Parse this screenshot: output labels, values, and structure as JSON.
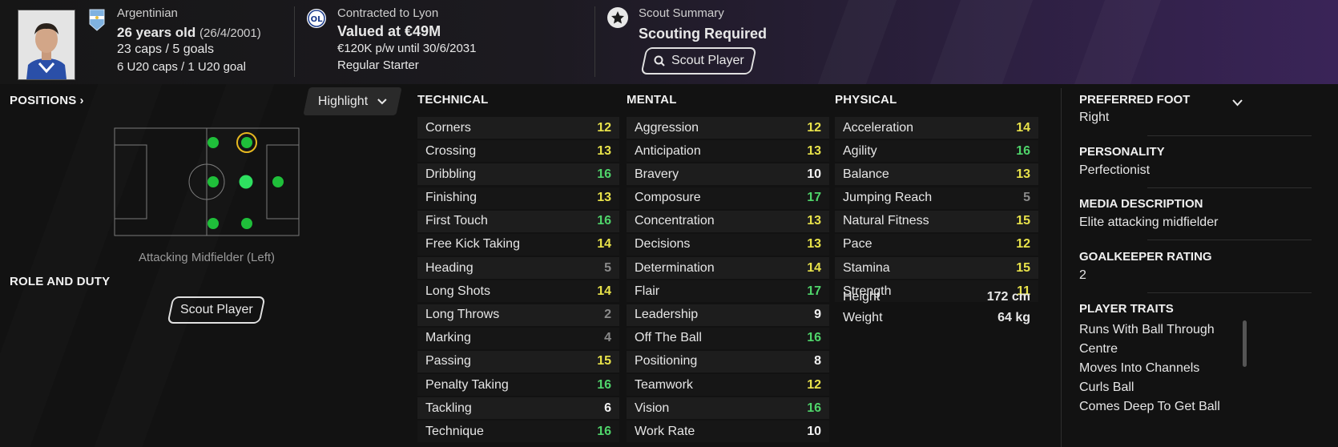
{
  "header": {
    "nationality": "Argentinian",
    "age": "26 years old",
    "dob": "(26/4/2001)",
    "caps": "23 caps / 5 goals",
    "u20": "6 U20 caps / 1 U20 goal",
    "contract_label": "Contracted to Lyon",
    "value": "Valued at €49M",
    "wage": "€120K p/w until 30/6/2031",
    "status": "Regular Starter",
    "scout_label": "Scout Summary",
    "scout_status": "Scouting Required",
    "scout_button": "Scout Player",
    "club_badge": "OL"
  },
  "positions": {
    "title": "POSITIONS",
    "highlight_label": "Highlight",
    "position_name": "Attacking Midfielder (Left)"
  },
  "role": {
    "title": "ROLE AND DUTY",
    "scout_button": "Scout Player"
  },
  "technical": {
    "title": "TECHNICAL",
    "rows": [
      {
        "label": "Corners",
        "value": "12",
        "tone": "yel"
      },
      {
        "label": "Crossing",
        "value": "13",
        "tone": "yel"
      },
      {
        "label": "Dribbling",
        "value": "16",
        "tone": "grn"
      },
      {
        "label": "Finishing",
        "value": "13",
        "tone": "yel"
      },
      {
        "label": "First Touch",
        "value": "16",
        "tone": "grn"
      },
      {
        "label": "Free Kick Taking",
        "value": "14",
        "tone": "yel"
      },
      {
        "label": "Heading",
        "value": "5",
        "tone": "gry"
      },
      {
        "label": "Long Shots",
        "value": "14",
        "tone": "yel"
      },
      {
        "label": "Long Throws",
        "value": "2",
        "tone": "gry"
      },
      {
        "label": "Marking",
        "value": "4",
        "tone": "gry"
      },
      {
        "label": "Passing",
        "value": "15",
        "tone": "yel"
      },
      {
        "label": "Penalty Taking",
        "value": "16",
        "tone": "grn"
      },
      {
        "label": "Tackling",
        "value": "6",
        "tone": "wht"
      },
      {
        "label": "Technique",
        "value": "16",
        "tone": "grn"
      }
    ]
  },
  "mental": {
    "title": "MENTAL",
    "rows": [
      {
        "label": "Aggression",
        "value": "12",
        "tone": "yel"
      },
      {
        "label": "Anticipation",
        "value": "13",
        "tone": "yel"
      },
      {
        "label": "Bravery",
        "value": "10",
        "tone": "wht"
      },
      {
        "label": "Composure",
        "value": "17",
        "tone": "grn"
      },
      {
        "label": "Concentration",
        "value": "13",
        "tone": "yel"
      },
      {
        "label": "Decisions",
        "value": "13",
        "tone": "yel"
      },
      {
        "label": "Determination",
        "value": "14",
        "tone": "yel"
      },
      {
        "label": "Flair",
        "value": "17",
        "tone": "grn"
      },
      {
        "label": "Leadership",
        "value": "9",
        "tone": "wht"
      },
      {
        "label": "Off The Ball",
        "value": "16",
        "tone": "grn"
      },
      {
        "label": "Positioning",
        "value": "8",
        "tone": "wht"
      },
      {
        "label": "Teamwork",
        "value": "12",
        "tone": "yel"
      },
      {
        "label": "Vision",
        "value": "16",
        "tone": "grn"
      },
      {
        "label": "Work Rate",
        "value": "10",
        "tone": "wht"
      }
    ]
  },
  "physical": {
    "title": "PHYSICAL",
    "rows": [
      {
        "label": "Acceleration",
        "value": "14",
        "tone": "yel"
      },
      {
        "label": "Agility",
        "value": "16",
        "tone": "grn"
      },
      {
        "label": "Balance",
        "value": "13",
        "tone": "yel"
      },
      {
        "label": "Jumping Reach",
        "value": "5",
        "tone": "gry"
      },
      {
        "label": "Natural Fitness",
        "value": "15",
        "tone": "yel"
      },
      {
        "label": "Pace",
        "value": "12",
        "tone": "yel"
      },
      {
        "label": "Stamina",
        "value": "15",
        "tone": "yel"
      },
      {
        "label": "Strength",
        "value": "11",
        "tone": "yel"
      }
    ],
    "height_label": "Height",
    "height_value": "172 cm",
    "weight_label": "Weight",
    "weight_value": "64 kg"
  },
  "right_panel": {
    "preferred_foot_label": "PREFERRED FOOT",
    "preferred_foot_value": "Right",
    "personality_label": "PERSONALITY",
    "personality_value": "Perfectionist",
    "media_label": "MEDIA DESCRIPTION",
    "media_value": "Elite attacking midfielder",
    "gk_label": "GOALKEEPER RATING",
    "gk_value": "2",
    "traits_label": "PLAYER TRAITS",
    "traits": [
      "Runs With Ball Through Centre",
      "Moves Into Channels",
      "Curls Ball",
      "Comes Deep To Get Ball"
    ]
  },
  "colors": {
    "value_high": "#4fd46a",
    "value_mid": "#e8e24a",
    "value_low": "#8a8a8a",
    "position_dot": "#1fbf3a",
    "position_ring": "#e6b820"
  }
}
